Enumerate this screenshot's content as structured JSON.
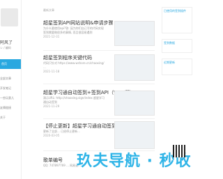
{
  "sidebar": {
    "name": "阿风了",
    "subtitle": "レ / 编码",
    "items": [
      {
        "label": "首页"
      },
      {
        "label": "全部文章"
      },
      {
        "label": "开发笔记"
      },
      {
        "label": "一些玩意儿"
      },
      {
        "label": "友情链接"
      },
      {
        "label": "关于"
      }
    ]
  },
  "main": {
    "header": "最新文章",
    "posts": [
      {
        "title": "超星签到API网站说明&申请步骤",
        "summary": "为什么要使用api?答: 因为你们自己写的代码实现签到需要做很多的事情, 而且很容易遇到",
        "date": "2021-12-31"
      },
      {
        "title": "超星签到程序关键代码",
        "summary": "代码只针对 https://www.wshore.cn/chaoxing/ ...",
        "date": "2021-11-18"
      },
      {
        "title": "超星学习通自动签到+签到API（WEB版）",
        "summary": "演示URL: http://chaoxing.sign/index 超星学习通自动签到",
        "date": "2021-11-29"
      },
      {
        "title": "【停止更新】超星学习通自动签到（Java版）",
        "summary": "更新了全部... 已经停止更新...",
        "date": "2020-03-05"
      },
      {
        "title": "歌单编号",
        "summary": "QQ: 747897769 ... 网易云...",
        "date": ""
      }
    ]
  },
  "right": {
    "box1_title": "已使用的签到插件",
    "box2_title": "签到数据",
    "box3_title": "近期更新"
  },
  "watermark": "玖夫导航 · 秒收"
}
